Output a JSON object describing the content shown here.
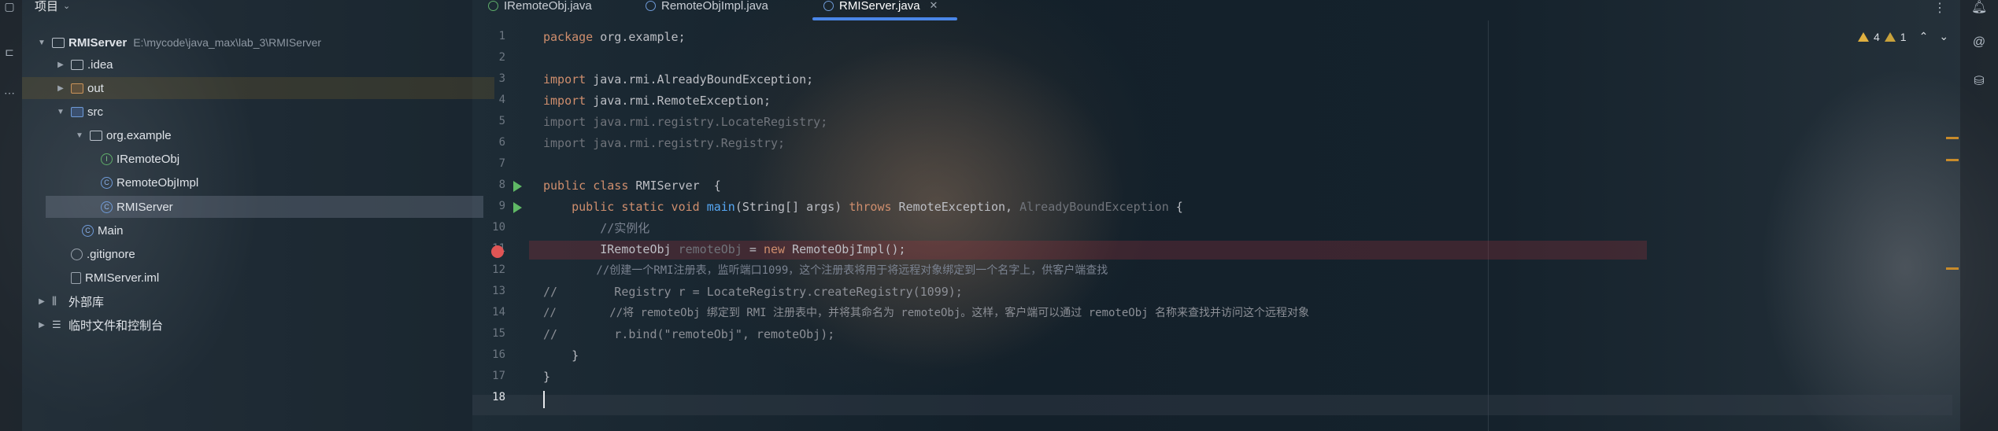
{
  "project": {
    "title": "项目",
    "tree": [
      {
        "label": "RMIServer",
        "path": "E:\\mycode\\java_max\\lab_3\\RMIServer"
      },
      {
        "label": ".idea"
      },
      {
        "label": "out"
      },
      {
        "label": "src"
      },
      {
        "label": "org.example"
      },
      {
        "label": "IRemoteObj"
      },
      {
        "label": "RemoteObjImpl"
      },
      {
        "label": "RMIServer"
      },
      {
        "label": "Main"
      },
      {
        "label": ".gitignore"
      },
      {
        "label": "RMIServer.iml"
      },
      {
        "label": "外部库"
      },
      {
        "label": "临时文件和控制台"
      }
    ]
  },
  "tabs": [
    {
      "label": "IRemoteObj.java"
    },
    {
      "label": "RemoteObjImpl.java"
    },
    {
      "label": "RMIServer.java",
      "active": true
    }
  ],
  "inspections": {
    "warnings": "4",
    "weak": "1"
  },
  "editor": {
    "line_numbers": [
      "1",
      "2",
      "3",
      "4",
      "5",
      "6",
      "7",
      "8",
      "9",
      "10",
      "11",
      "12",
      "13",
      "14",
      "15",
      "16",
      "17",
      "18"
    ],
    "lines": {
      "l1": {
        "a": "package",
        "b": " org.example;"
      },
      "l3": {
        "a": "import",
        "b": " java.rmi.AlreadyBoundException;"
      },
      "l4": {
        "a": "import",
        "b": " java.rmi.RemoteException;"
      },
      "l5": "import java.rmi.registry.LocateRegistry;",
      "l6": "import java.rmi.registry.Registry;",
      "l8": {
        "a": "public class",
        "b": " RMIServer  {"
      },
      "l9": {
        "a": "    public static void ",
        "fn": "main",
        "b": "(String[] args) ",
        "kw2": "throws",
        "c": " RemoteException, ",
        "dim": "AlreadyBoundException",
        "d": " {"
      },
      "l10": "        //实例化",
      "l11": {
        "a": "        IRemoteObj ",
        "dim": "remoteObj",
        "b": " = ",
        "kw": "new",
        "c": " RemoteObjImpl();"
      },
      "l12": "        //创建一个RMI注册表，监听端口1099，这个注册表将用于将远程对象绑定到一个名字上，供客户端查找",
      "l13": "//        Registry r = LocateRegistry.createRegistry(1099);",
      "l14": "//        //将 remoteObj 绑定到 RMI 注册表中，并将其命名为 remoteObj。这样，客户端可以通过 remoteObj 名称来查找并访问这个远程对象",
      "l15": "//        r.bind(\"remoteObj\", remoteObj);",
      "l16": "    }",
      "l17": "}"
    }
  }
}
